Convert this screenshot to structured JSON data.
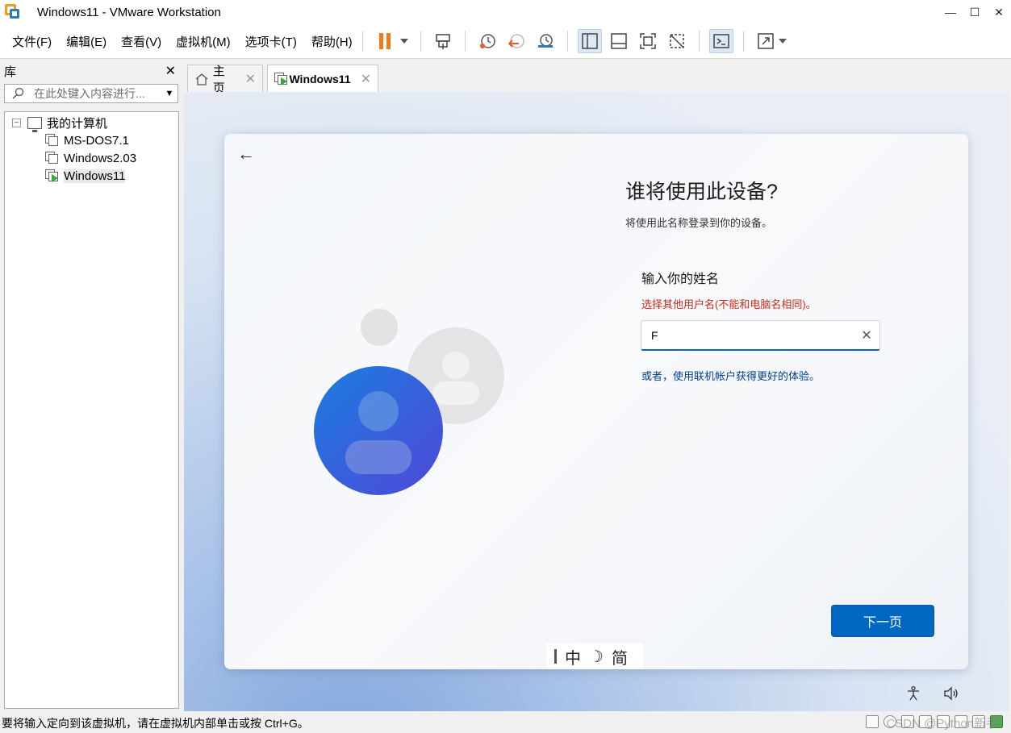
{
  "window": {
    "title": "Windows11 - VMware Workstation",
    "controls": [
      "—",
      "☐",
      "✕"
    ]
  },
  "menu": {
    "items": [
      "文件(F)",
      "编辑(E)",
      "查看(V)",
      "虚拟机(M)",
      "选项卡(T)",
      "帮助(H)"
    ]
  },
  "toolbar": {
    "icons": [
      "pause-icon",
      "dropdown-icon",
      "send-ctrl-alt-del-icon",
      "snapshot-icon",
      "revert-snapshot-icon",
      "snapshot-manager-icon",
      "show-library-icon",
      "thumbnail-bar-icon",
      "fullscreen-icon",
      "unity-icon",
      "console-icon",
      "stretch-icon",
      "stretch-dropdown-icon"
    ]
  },
  "library": {
    "title": "库",
    "close": "✕",
    "search_placeholder": "在此处键入内容进行...",
    "tree": {
      "root": "我的计算机",
      "vms": [
        "MS-DOS7.1",
        "Windows2.03",
        "Windows11"
      ],
      "selected": "Windows11"
    }
  },
  "tabs": [
    {
      "label": "主页",
      "close": "✕"
    },
    {
      "label": "Windows11",
      "close": "✕"
    }
  ],
  "oobe": {
    "title": "谁将使用此设备?",
    "subtitle": "将使用此名称登录到你的设备。",
    "name_label": "输入你的姓名",
    "error": "选择其他用户名(不能和电脑名相同)。",
    "name_value": "F",
    "clear": "✕",
    "online_link": "或者，使用联机帐户获得更好的体验。",
    "next_button": "下一页",
    "back": "←"
  },
  "ime": {
    "mode": "中",
    "moon": "☽",
    "script": "简"
  },
  "status": {
    "text": "要将输入定向到该虚拟机，请在虚拟机内部单击或按 Ctrl+G。",
    "watermark": "CSDN @Python新手"
  }
}
